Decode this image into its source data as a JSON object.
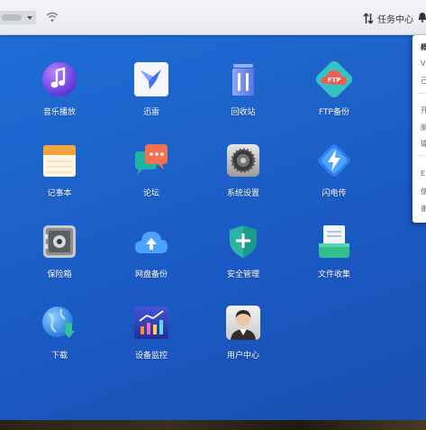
{
  "topbar": {
    "task_center_label": "任务中心"
  },
  "side_panel": {
    "lines": [
      "概",
      "V",
      "己",
      "开",
      "腿",
      "璩",
      "E",
      "使",
      "谢"
    ]
  },
  "apps": [
    {
      "label": "音乐播放",
      "icon": "music-note-icon"
    },
    {
      "label": "迅雷",
      "icon": "thunder-bird-icon"
    },
    {
      "label": "回收站",
      "icon": "trash-bin-icon"
    },
    {
      "label": "FTP备份",
      "icon": "ftp-cloud-icon",
      "badge": "FTP"
    },
    {
      "label": "记事本",
      "icon": "notepad-icon"
    },
    {
      "label": "论坛",
      "icon": "forum-chat-icon"
    },
    {
      "label": "系统设置",
      "icon": "gear-settings-icon"
    },
    {
      "label": "闪电传",
      "icon": "lightning-transfer-icon"
    },
    {
      "label": "保险箱",
      "icon": "safe-box-icon"
    },
    {
      "label": "网盘备份",
      "icon": "cloud-upload-icon"
    },
    {
      "label": "安全管理",
      "icon": "shield-plus-icon"
    },
    {
      "label": "文件收集",
      "icon": "file-collect-icon"
    },
    {
      "label": "下载",
      "icon": "globe-download-icon"
    },
    {
      "label": "设备监控",
      "icon": "device-monitor-chart-icon"
    },
    {
      "label": "用户中心",
      "icon": "user-center-icon"
    }
  ],
  "colors": {
    "desktop_top": "#1f6fd6",
    "desktop_bottom": "#1b4fb0",
    "topbar_bg": "#eef0f4",
    "label_text": "#ffffff"
  }
}
